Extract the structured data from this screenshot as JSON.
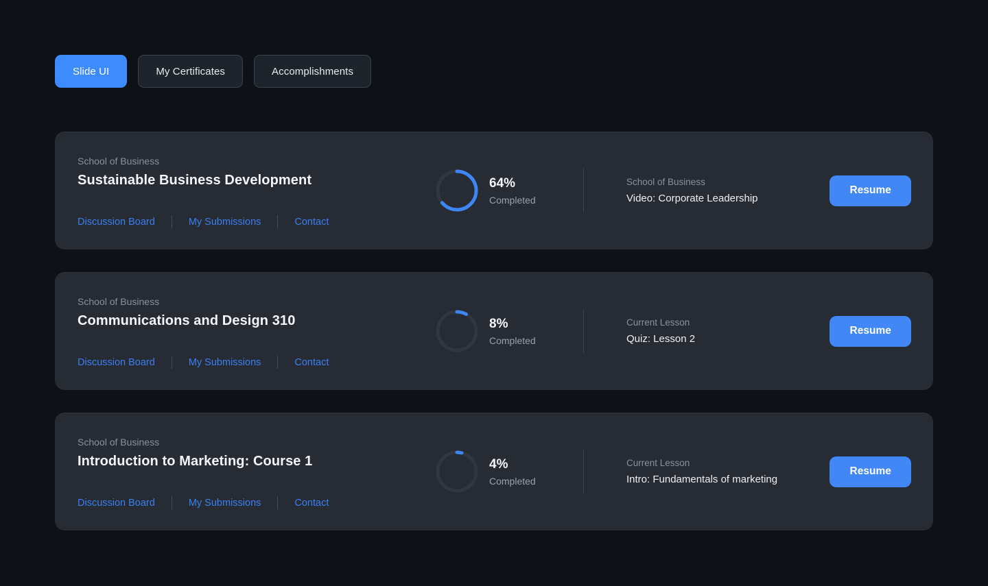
{
  "colors": {
    "accent_blue": "#3d8bfd",
    "link_blue": "#3b7ff2",
    "page_bg": "#0e1218",
    "card_bg": "#262b34"
  },
  "tabs": [
    {
      "label": "Slide UI",
      "active": true
    },
    {
      "label": "My Certificates",
      "active": false
    },
    {
      "label": "Accomplishments",
      "active": false
    }
  ],
  "courses": [
    {
      "school": "School of Business",
      "title": "Sustainable Business Development",
      "links": {
        "discussion": "Discussion Board",
        "submissions": "My Submissions",
        "contact": "Contact"
      },
      "progress_percent": 64,
      "percent_label": "64%",
      "completed_label": "Completed",
      "lesson_label": "School of Business",
      "lesson_title": "Video: Corporate Leadership",
      "resume_label": "Resume"
    },
    {
      "school": "School of Business",
      "title": "Communications and Design 310",
      "links": {
        "discussion": "Discussion Board",
        "submissions": "My Submissions",
        "contact": "Contact"
      },
      "progress_percent": 8,
      "percent_label": "8%",
      "completed_label": "Completed",
      "lesson_label": "Current Lesson",
      "lesson_title": "Quiz: Lesson 2",
      "resume_label": "Resume"
    },
    {
      "school": "School of Business",
      "title": "Introduction to Marketing: Course 1",
      "links": {
        "discussion": "Discussion Board",
        "submissions": "My Submissions",
        "contact": "Contact"
      },
      "progress_percent": 4,
      "percent_label": "4%",
      "completed_label": "Completed",
      "lesson_label": "Current Lesson",
      "lesson_title": "Intro: Fundamentals of marketing",
      "resume_label": "Resume"
    }
  ]
}
